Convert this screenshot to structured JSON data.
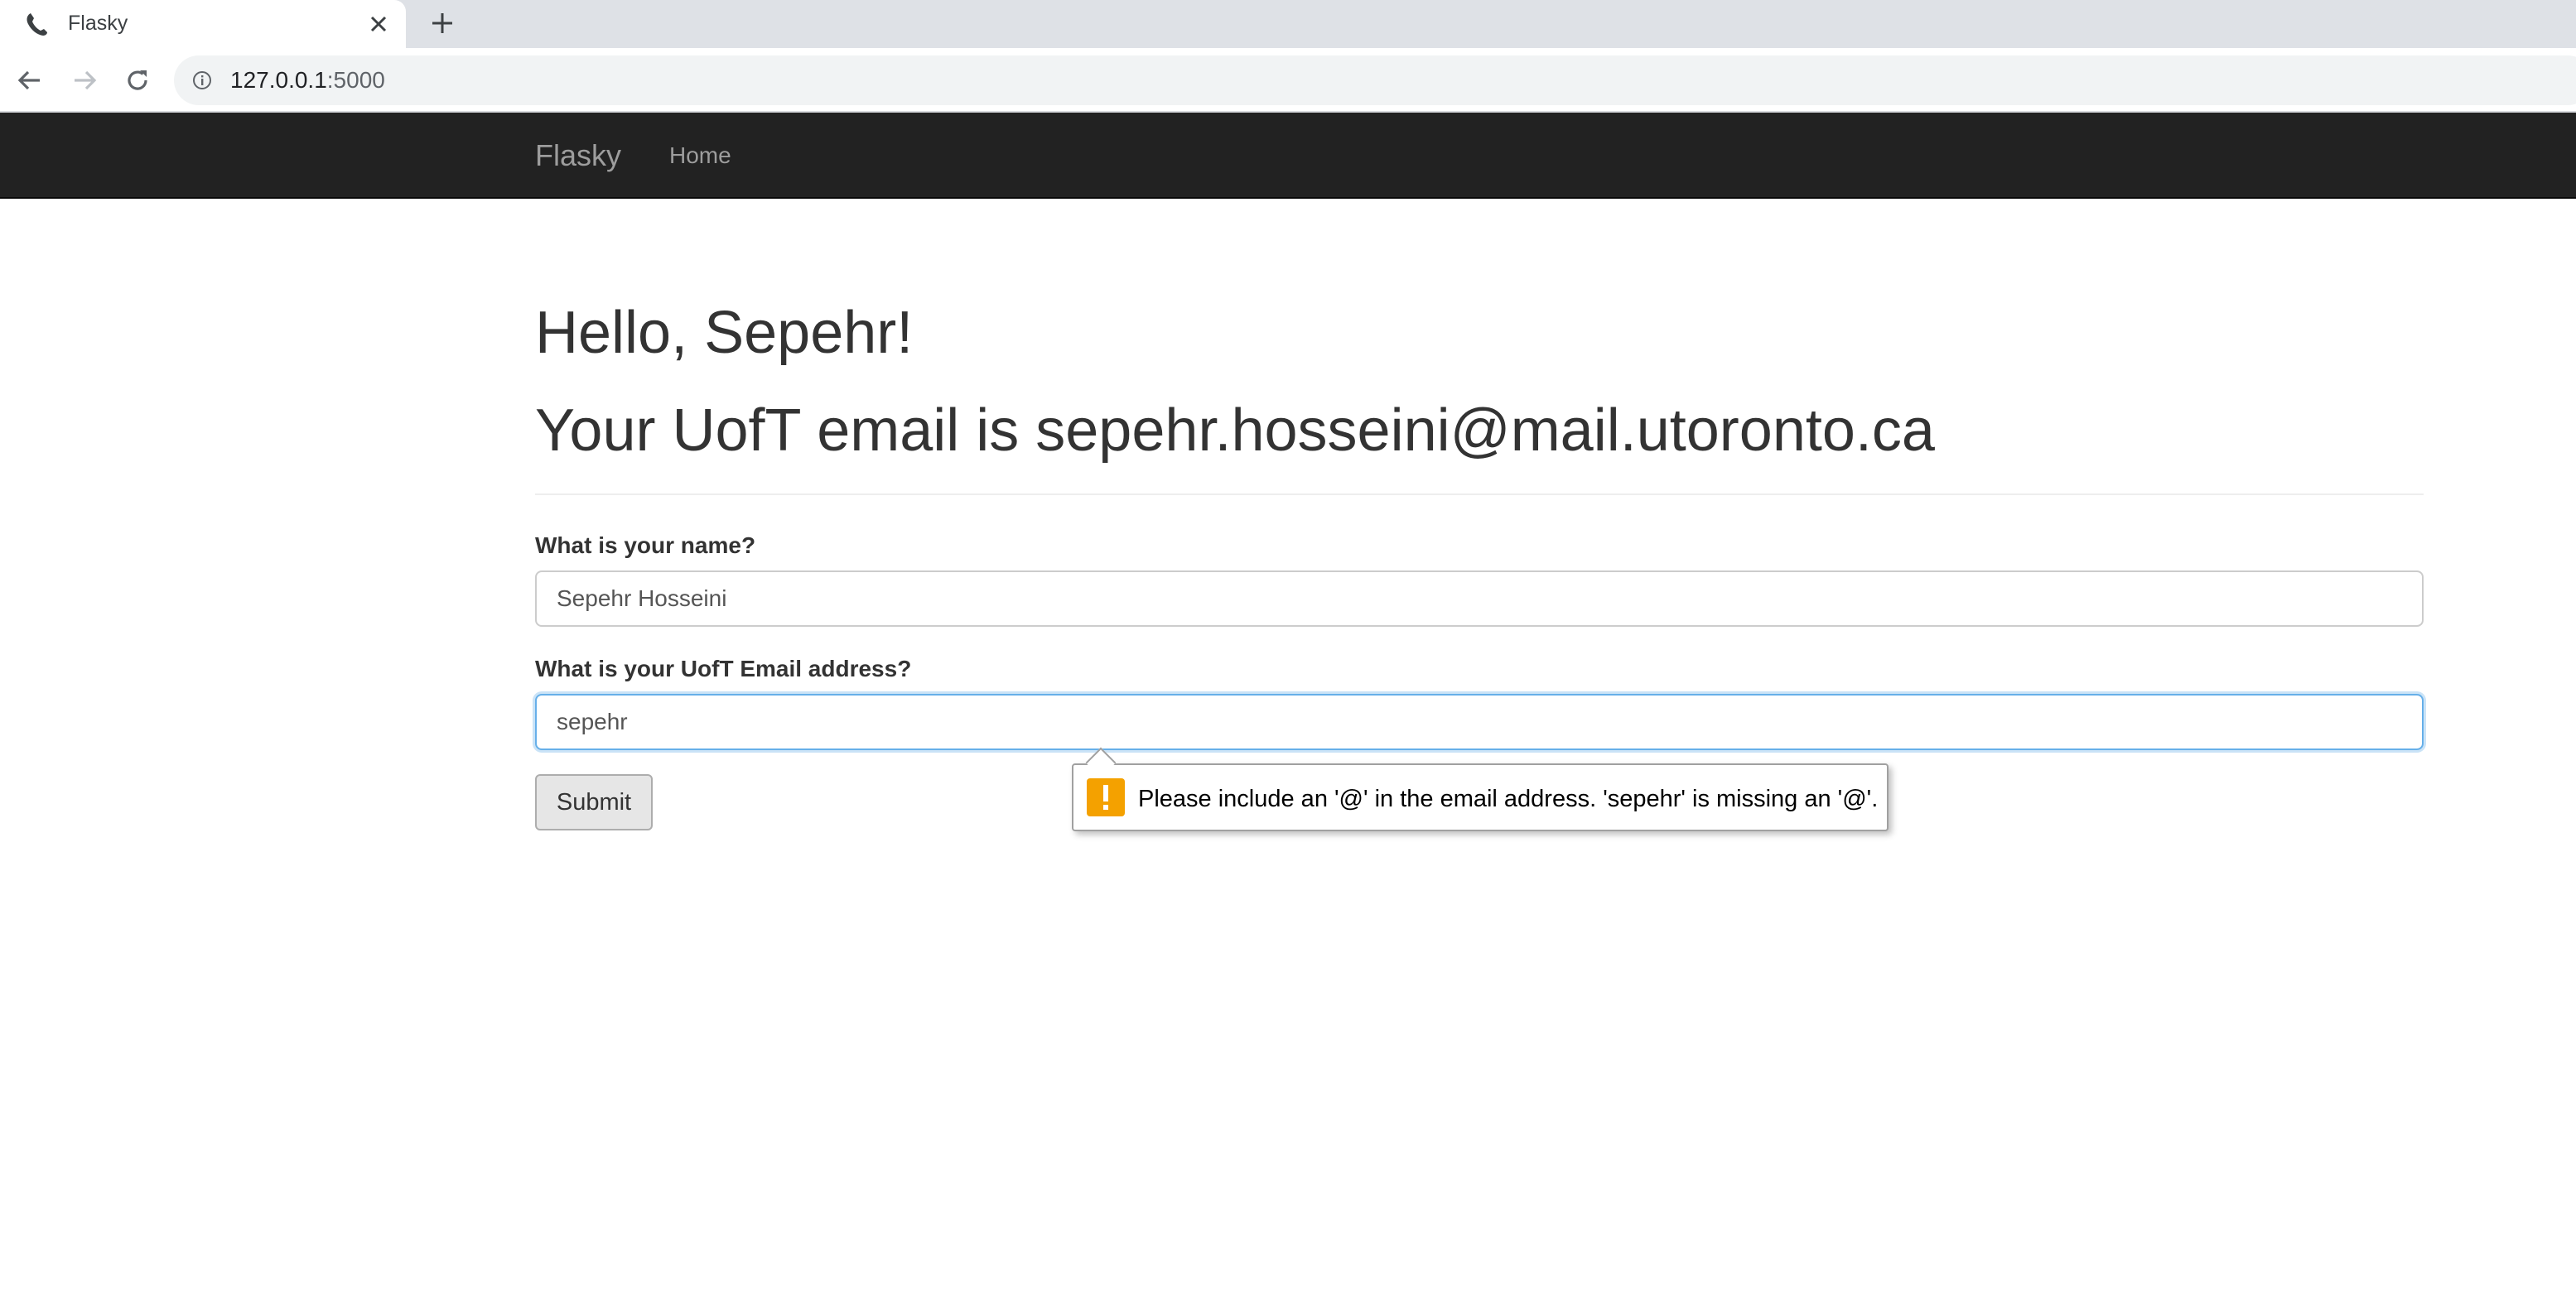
{
  "browser": {
    "tab": {
      "title": "Flasky",
      "favicon": "phone-icon",
      "close_icon": "close-icon"
    },
    "new_tab_icon": "plus-icon",
    "toolbar": {
      "back_icon": "back-arrow-icon",
      "forward_icon": "forward-arrow-icon",
      "reload_icon": "reload-icon",
      "info_icon": "info-icon"
    },
    "url": {
      "host": "127.0.0.1",
      "port": ":5000"
    }
  },
  "navbar": {
    "brand": "Flasky",
    "links": [
      {
        "label": "Home"
      }
    ]
  },
  "main": {
    "greeting": "Hello, Sepehr!",
    "email_heading": "Your UofT email is sepehr.hosseini@mail.utoronto.ca",
    "form": {
      "name_label": "What is your name?",
      "name_value": "Sepehr Hosseini",
      "email_label": "What is your UofT Email address?",
      "email_value": "sepehr",
      "submit_label": "Submit"
    },
    "validation": {
      "icon": "warning-icon",
      "message": "Please include an '@' in the email address. 'sepehr' is missing an '@'."
    }
  },
  "colors": {
    "navbar_bg": "#222222",
    "navbar_text": "#9d9d9d",
    "focus_border": "#66afe9",
    "warning": "#f4a100",
    "tabstrip_bg": "#dee1e6"
  }
}
